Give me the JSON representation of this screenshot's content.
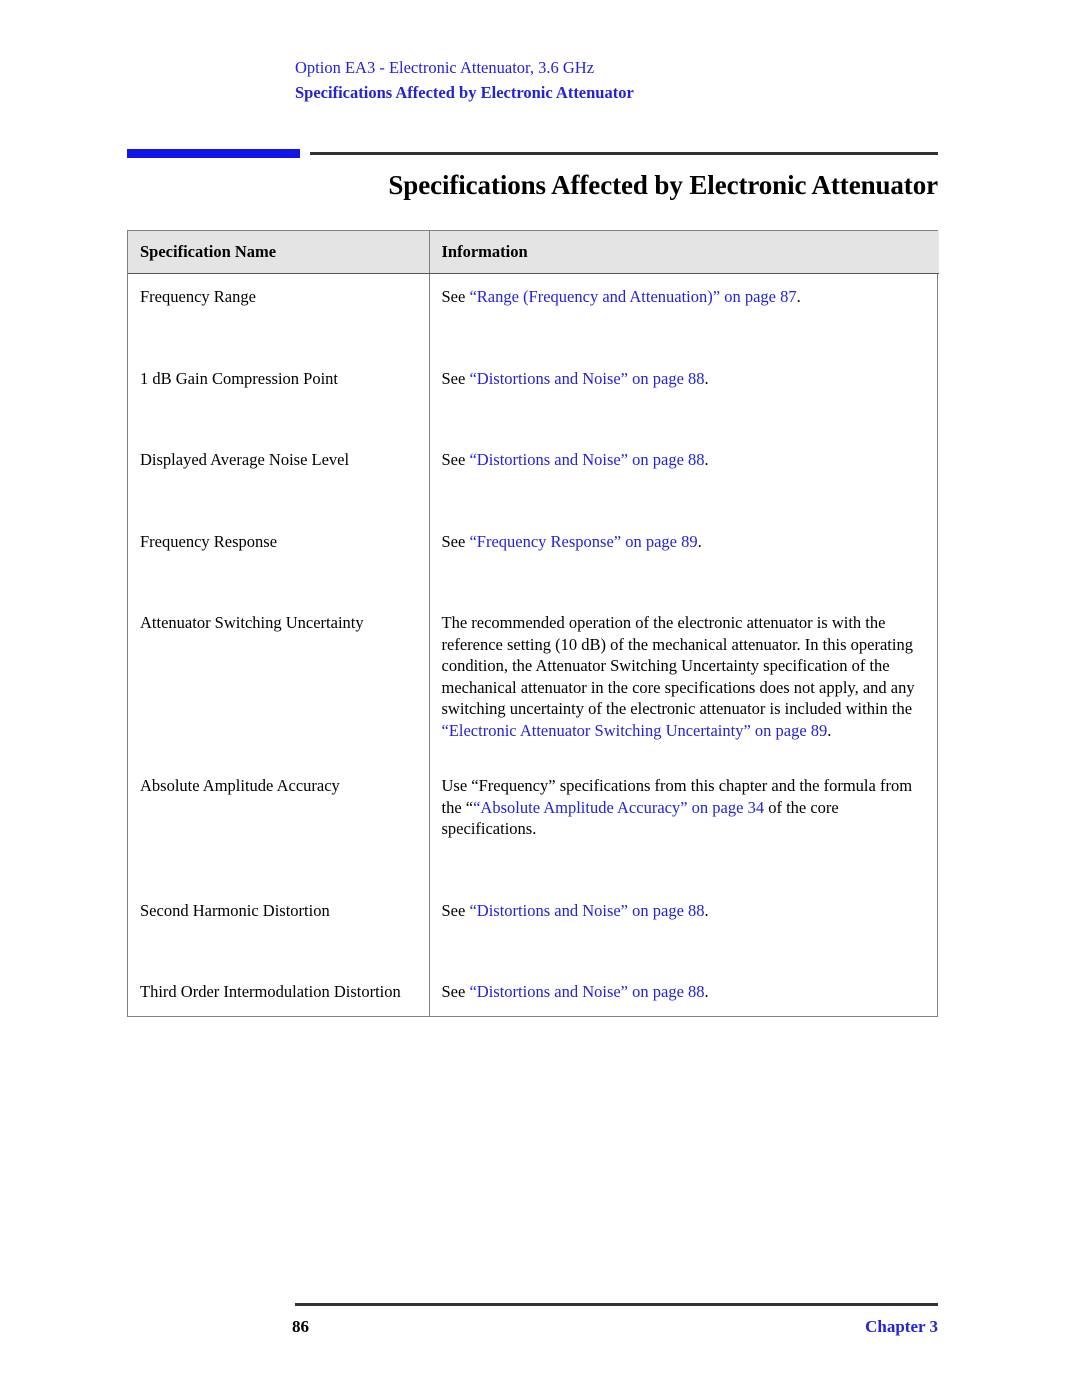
{
  "running_header": {
    "option_line": "Option EA3 - Electronic Attenuator, 3.6 GHz",
    "section_line": "Specifications Affected by Electronic Attenuator"
  },
  "page_title": "Specifications Affected by Electronic Attenuator",
  "colors": {
    "link_blue": "#2222dd",
    "header_bar_blue": "#1414e6",
    "rule_gray": "#333333",
    "table_border": "#808080",
    "table_header_bg": "#e4e4e4"
  },
  "table": {
    "headers": [
      "Specification Name",
      "Information"
    ],
    "rows": [
      {
        "name": "Frequency Range",
        "info_segments": [
          {
            "text": "See ",
            "link": false
          },
          {
            "text": "“Range (Frequency and Attenuation)” on page  87",
            "link": true
          },
          {
            "text": ".",
            "link": false
          }
        ]
      },
      {
        "name": "1 dB Gain Compression Point",
        "info_segments": [
          {
            "text": "See ",
            "link": false
          },
          {
            "text": "“Distortions and Noise” on page  88",
            "link": true
          },
          {
            "text": ".",
            "link": false
          }
        ]
      },
      {
        "name": "Displayed Average Noise Level",
        "info_segments": [
          {
            "text": "See ",
            "link": false
          },
          {
            "text": "“Distortions and Noise” on page  88",
            "link": true
          },
          {
            "text": ".",
            "link": false
          }
        ]
      },
      {
        "name": "Frequency Response",
        "info_segments": [
          {
            "text": "See ",
            "link": false
          },
          {
            "text": "“Frequency Response” on page  89",
            "link": true
          },
          {
            "text": ".",
            "link": false
          }
        ]
      },
      {
        "name": "Attenuator Switching Uncertainty",
        "info_segments": [
          {
            "text": "The recommended operation of the electronic attenuator is with the reference setting (10 dB) of the mechanical attenuator. In this operating condition, the Attenuator Switching Uncertainty specification of the mechanical attenuator in the core specifications does not apply, and any switching uncertainty of the electronic attenuator is included within the ",
            "link": false
          },
          {
            "text": "“Electronic Attenuator Switching Uncertainty” on page  89",
            "link": true
          },
          {
            "text": ".",
            "link": false
          }
        ]
      },
      {
        "name": "Absolute Amplitude Accuracy",
        "info_segments": [
          {
            "text": "Use “Frequency” specifications from this chapter and the formula from the “",
            "link": false
          },
          {
            "text": "“Absolute Amplitude Accuracy” on page  34",
            "link": true
          },
          {
            "text": " of the core specifications.",
            "link": false
          }
        ]
      },
      {
        "name": "Second Harmonic Distortion",
        "info_segments": [
          {
            "text": "See ",
            "link": false
          },
          {
            "text": "“Distortions and Noise” on page  88",
            "link": true
          },
          {
            "text": ".",
            "link": false
          }
        ]
      },
      {
        "name": "Third Order Intermodulation Distortion",
        "info_segments": [
          {
            "text": "See ",
            "link": false
          },
          {
            "text": "“Distortions and Noise” on page  88",
            "link": true
          },
          {
            "text": ".",
            "link": false
          }
        ]
      }
    ]
  },
  "footer": {
    "page_number": "86",
    "chapter_label": "Chapter 3"
  }
}
